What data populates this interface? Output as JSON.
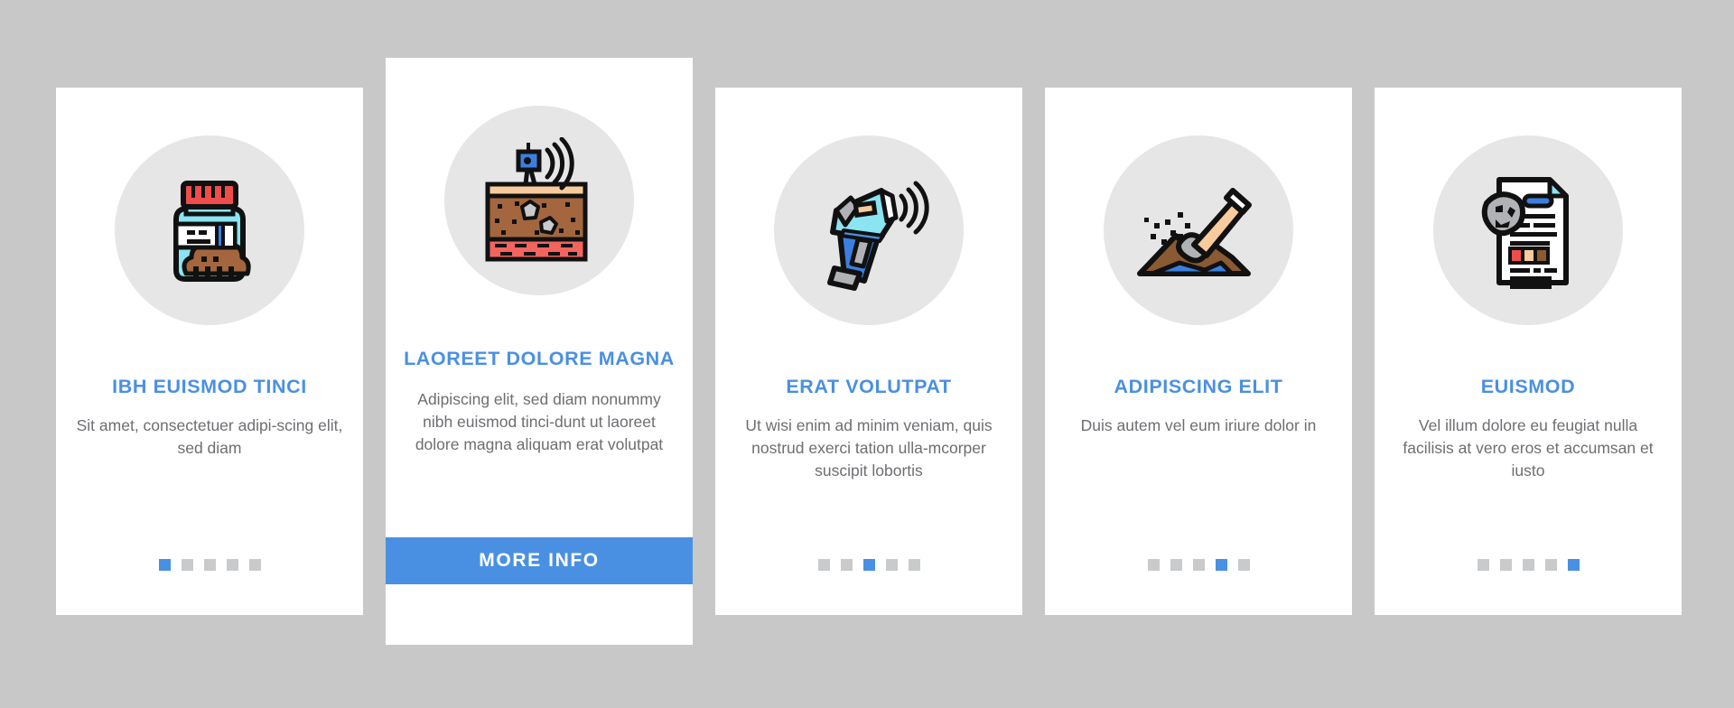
{
  "theme": {
    "background": "#c8c8c8",
    "card_background": "#ffffff",
    "accent": "#4a90e2",
    "title_color": "#4a90e2",
    "body_text_color": "#6d6e71",
    "icon_circle": "#e6e6e6",
    "dot_inactive": "#c9cacb",
    "dot_active": "#4a90e2"
  },
  "cards": [
    {
      "icon_name": "soil-sample-jar-icon",
      "title": "IBH EUISMOD TINCI",
      "description": "Sit amet, consectetuer adipi-scing elit, sed diam",
      "dots_total": 5,
      "dots_active_index": 0,
      "has_button": false
    },
    {
      "icon_name": "soil-layers-sensor-icon",
      "title": "LAOREET DOLORE MAGNA",
      "description": "Adipiscing elit, sed diam nonummy nibh euismod tinci-dunt ut laoreet dolore magna aliquam erat volutpat",
      "dots_total": 0,
      "dots_active_index": -1,
      "has_button": true,
      "button_label": "MORE INFO"
    },
    {
      "icon_name": "handheld-scanner-icon",
      "title": "ERAT VOLUTPAT",
      "description": "Ut wisi enim ad minim veniam, quis nostrud exerci tation ulla-mcorper suscipit lobortis",
      "dots_total": 5,
      "dots_active_index": 2,
      "has_button": false
    },
    {
      "icon_name": "shovel-digging-soil-icon",
      "title": "ADIPISCING ELIT",
      "description": "Duis autem vel eum iriure dolor in",
      "dots_total": 5,
      "dots_active_index": 3,
      "has_button": false
    },
    {
      "icon_name": "soil-report-document-icon",
      "title": "EUISMOD",
      "description": "Vel illum dolore eu feugiat nulla facilisis at vero eros et accumsan et iusto",
      "dots_total": 5,
      "dots_active_index": 4,
      "has_button": false
    }
  ]
}
